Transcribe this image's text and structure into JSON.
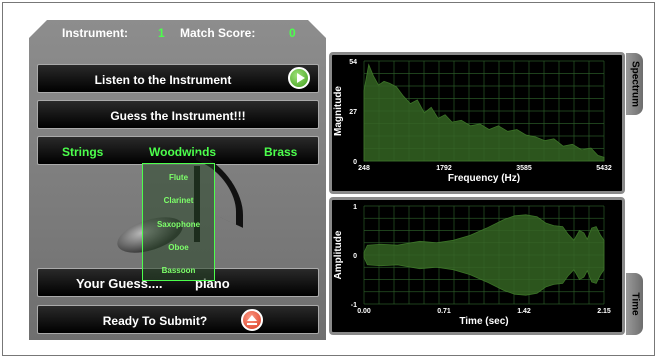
{
  "header": {
    "instrument_label": "Instrument:",
    "instrument_value": "1",
    "score_label": "Match Score:",
    "score_value": "0"
  },
  "buttons": {
    "listen": "Listen to the Instrument",
    "guess_prompt": "Guess the Instrument!!!",
    "submit": "Ready To Submit?"
  },
  "categories": [
    "Strings",
    "Woodwinds",
    "Brass"
  ],
  "dropdown": {
    "options": [
      "Flute",
      "Clarinet",
      "Saxophone",
      "Oboe",
      "Bassoon"
    ]
  },
  "guess": {
    "label": "Your Guess....",
    "value": "piano"
  },
  "tabs": {
    "spectrum": "Spectrum",
    "time": "Time"
  },
  "colors": {
    "accent_green": "#4cff4c",
    "fill_green": "#2f5a1f",
    "panel_bg": "#000000"
  },
  "icons": {
    "listen": "play-icon",
    "submit": "eject-icon"
  },
  "chart_data": [
    {
      "type": "area",
      "xlabel": "Frequency (Hz)",
      "ylabel": "Magnitude",
      "xticks": [
        "248",
        "1792",
        "3585",
        "5432"
      ],
      "yticks": [
        "54",
        "27",
        "0"
      ],
      "xlim": [
        248,
        5432
      ],
      "ylim": [
        0,
        54
      ],
      "x": [
        248,
        350,
        450,
        560,
        680,
        800,
        950,
        1100,
        1250,
        1400,
        1550,
        1700,
        1850,
        2000,
        2150,
        2350,
        2550,
        2750,
        2950,
        3150,
        3350,
        3550,
        3750,
        3950,
        4150,
        4350,
        4550,
        4750,
        4950,
        5150,
        5300,
        5432
      ],
      "y": [
        38,
        52,
        46,
        41,
        43,
        42,
        40,
        35,
        31,
        33,
        26,
        29,
        23,
        25,
        21,
        22,
        19,
        20,
        17,
        19,
        16,
        17,
        14,
        13,
        11,
        12,
        8,
        9,
        6,
        7,
        3,
        2
      ]
    },
    {
      "type": "area",
      "xlabel": "Time (sec)",
      "ylabel": "Amplitude",
      "xticks": [
        "0.00",
        "0.71",
        "1.42",
        "2.15"
      ],
      "yticks": [
        "1",
        "0",
        "-1"
      ],
      "xlim": [
        0,
        2.15
      ],
      "ylim": [
        -1,
        1
      ],
      "x": [
        0.0,
        0.03,
        0.15,
        0.3,
        0.5,
        0.65,
        0.8,
        0.95,
        1.1,
        1.25,
        1.35,
        1.45,
        1.55,
        1.63,
        1.7,
        1.78,
        1.83,
        1.88,
        1.93,
        1.97,
        2.0,
        2.04,
        2.08,
        2.12,
        2.15
      ],
      "y": [
        0.05,
        0.2,
        0.22,
        0.2,
        0.28,
        0.25,
        0.3,
        0.4,
        0.55,
        0.72,
        0.8,
        0.82,
        0.78,
        0.65,
        0.6,
        0.58,
        0.42,
        0.3,
        0.5,
        0.45,
        0.32,
        0.55,
        0.58,
        0.4,
        0.3
      ]
    }
  ]
}
